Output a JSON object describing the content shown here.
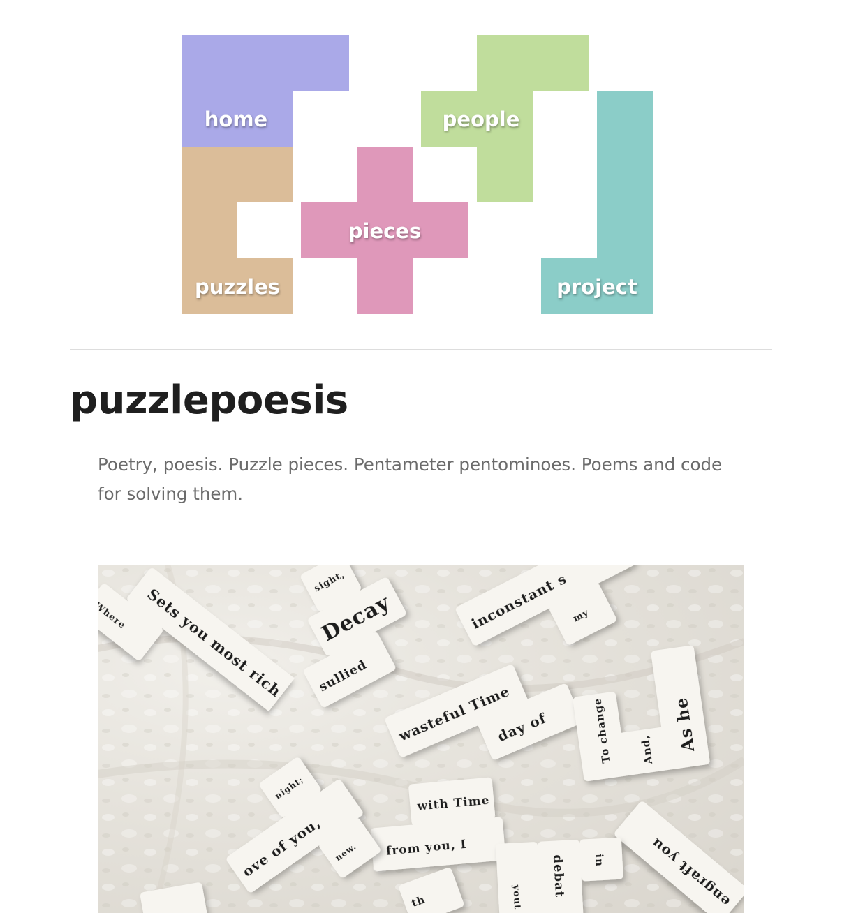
{
  "nav": {
    "home": "home",
    "people": "people",
    "pieces": "pieces",
    "puzzles": "puzzles",
    "project": "project"
  },
  "colors": {
    "home": "#aaa9e8",
    "puzzles": "#dbbd99",
    "pieces": "#df98ba",
    "people": "#c0dd9c",
    "project": "#8bcdc8"
  },
  "site": {
    "title": "puzzlepoesis",
    "tagline": "Poetry, poesis. Puzzle pieces. Pentameter pentominoes. Poems and code for solving them."
  },
  "photo": {
    "tiles": [
      "Where",
      "Sets you most rich",
      "sight,",
      "Decay",
      "sullied",
      "inconstant s",
      "my",
      "wasteful Time",
      "day of",
      "To change",
      "And,",
      "As he",
      "with Time",
      "from you, I",
      "night;",
      "ove of you,",
      "new.",
      "engraft you",
      "in",
      "debat",
      "yout",
      "th"
    ]
  }
}
